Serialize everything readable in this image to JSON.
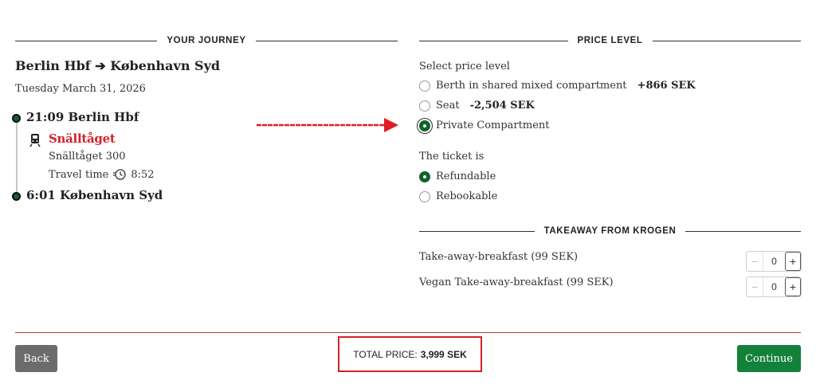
{
  "journey": {
    "section_title": "YOUR JOURNEY",
    "route": "Berlin Hbf ➔ København Syd",
    "date": "Tuesday March 31, 2026",
    "departure": "21:09 Berlin Hbf",
    "arrival": "6:01 København Syd",
    "operator": "Snälltåget",
    "train_name": "Snälltåget 300",
    "travel_time_label": "Travel time",
    "travel_time_value": "8:52",
    "icons": {
      "train": "train-icon",
      "clock": "clock-icon",
      "arrow": "red-arrow-icon"
    },
    "colors": {
      "operator": "#d3202a",
      "timeline_dot": "#12622e"
    }
  },
  "price_level": {
    "section_title": "PRICE LEVEL",
    "select_label": "Select price level",
    "options": [
      {
        "label": "Berth in shared mixed compartment",
        "price": "+866 SEK",
        "selected": false
      },
      {
        "label": "Seat",
        "price": "-2,504 SEK",
        "selected": false
      },
      {
        "label": "Private Compartment",
        "price": "",
        "selected": true
      }
    ],
    "ticket_label": "The ticket is",
    "ticket_options": [
      {
        "label": "Refundable",
        "selected": true
      },
      {
        "label": "Rebookable",
        "selected": false
      }
    ]
  },
  "takeaway": {
    "section_title": "TAKEAWAY FROM KROGEN",
    "items": [
      {
        "label": "Take-away-breakfast (99 SEK)",
        "quantity": "0"
      },
      {
        "label": "Vegan Take-away-breakfast (99 SEK)",
        "quantity": "0"
      }
    ],
    "minus": "−",
    "plus": "+"
  },
  "footer": {
    "back_label": "Back",
    "total_label": "TOTAL PRICE:",
    "total_value": "3,999 SEK",
    "continue_label": "Continue",
    "colors": {
      "continue": "#13813a",
      "back": "#6b6b6b",
      "highlight": "#d3202a"
    }
  }
}
